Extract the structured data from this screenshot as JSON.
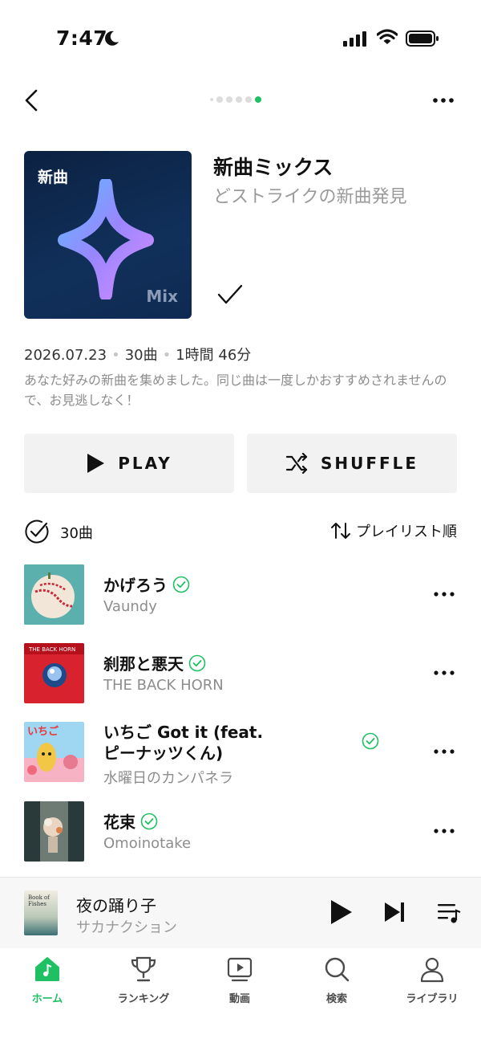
{
  "status_bar": {
    "time": "7:47"
  },
  "playlist": {
    "cover_tag": "新曲",
    "cover_mix": "Mix",
    "title": "新曲ミックス",
    "subtitle": "どストライクの新曲発見",
    "date": "2026.07.23",
    "track_count": "30曲",
    "duration": "1時間 46分",
    "description": "あなた好みの新曲を集めました。同じ曲は一度しかおすすめされませんので、お見逃しなく！"
  },
  "actions": {
    "play_label": "PLAY",
    "shuffle_label": "SHUFFLE"
  },
  "list_header": {
    "count": "30曲",
    "sort_label": "プレイリスト順"
  },
  "tracks": [
    {
      "title": "かげろう",
      "artist": "Vaundy"
    },
    {
      "title": "刹那と悪天",
      "artist": "THE BACK HORN"
    },
    {
      "title_line1": "いちご Got it (feat.",
      "title_line2": "ピーナッツくん)",
      "artist": "水曜日のカンパネラ"
    },
    {
      "title": "花束",
      "artist": "Omoinotake"
    }
  ],
  "now_playing": {
    "title": "夜の踊り子",
    "artist": "サカナクション",
    "cover_text": "Book of Fishes"
  },
  "tabs": [
    {
      "label": "ホーム",
      "icon": "home-icon"
    },
    {
      "label": "ランキング",
      "icon": "trophy-icon"
    },
    {
      "label": "動画",
      "icon": "video-icon"
    },
    {
      "label": "検索",
      "icon": "search-icon"
    },
    {
      "label": "ライブラリ",
      "icon": "profile-icon"
    }
  ],
  "colors": {
    "accent": "#1fc063",
    "cover_bg": "#0f2a52",
    "button_bg": "#f2f2f2"
  }
}
